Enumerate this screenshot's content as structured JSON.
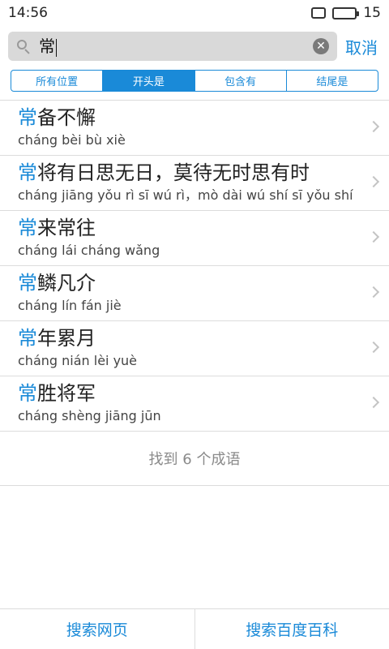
{
  "status_bar": {
    "time": "14:56",
    "battery_level": "15",
    "battery_fraction": 0.15
  },
  "search": {
    "query": "常"
  },
  "cancel_label": "取消",
  "tabs": [
    {
      "label": "所有位置",
      "active": false
    },
    {
      "label": "开头是",
      "active": true
    },
    {
      "label": "包含有",
      "active": false
    },
    {
      "label": "结尾是",
      "active": false
    }
  ],
  "results": [
    {
      "highlight": "常",
      "rest": "备不懈",
      "pinyin": "cháng bèi bù xiè"
    },
    {
      "highlight": "常",
      "rest": "将有日思无日，莫待无时思有时",
      "pinyin": "cháng jiāng yǒu rì sī wú rì，mò dài wú shí sī yǒu shí"
    },
    {
      "highlight": "常",
      "rest": "来常往",
      "pinyin": "cháng lái cháng wǎng"
    },
    {
      "highlight": "常",
      "rest": "鳞凡介",
      "pinyin": "cháng lín fán jiè"
    },
    {
      "highlight": "常",
      "rest": "年累月",
      "pinyin": "cháng nián lèi yuè"
    },
    {
      "highlight": "常",
      "rest": "胜将军",
      "pinyin": "cháng shèng jiāng jūn"
    }
  ],
  "result_count": "找到 6 个成语",
  "bottom": {
    "search_web": "搜索网页",
    "search_baike": "搜索百度百科"
  },
  "colors": {
    "accent": "#1a8ad8",
    "divider": "#dcdcdc"
  }
}
